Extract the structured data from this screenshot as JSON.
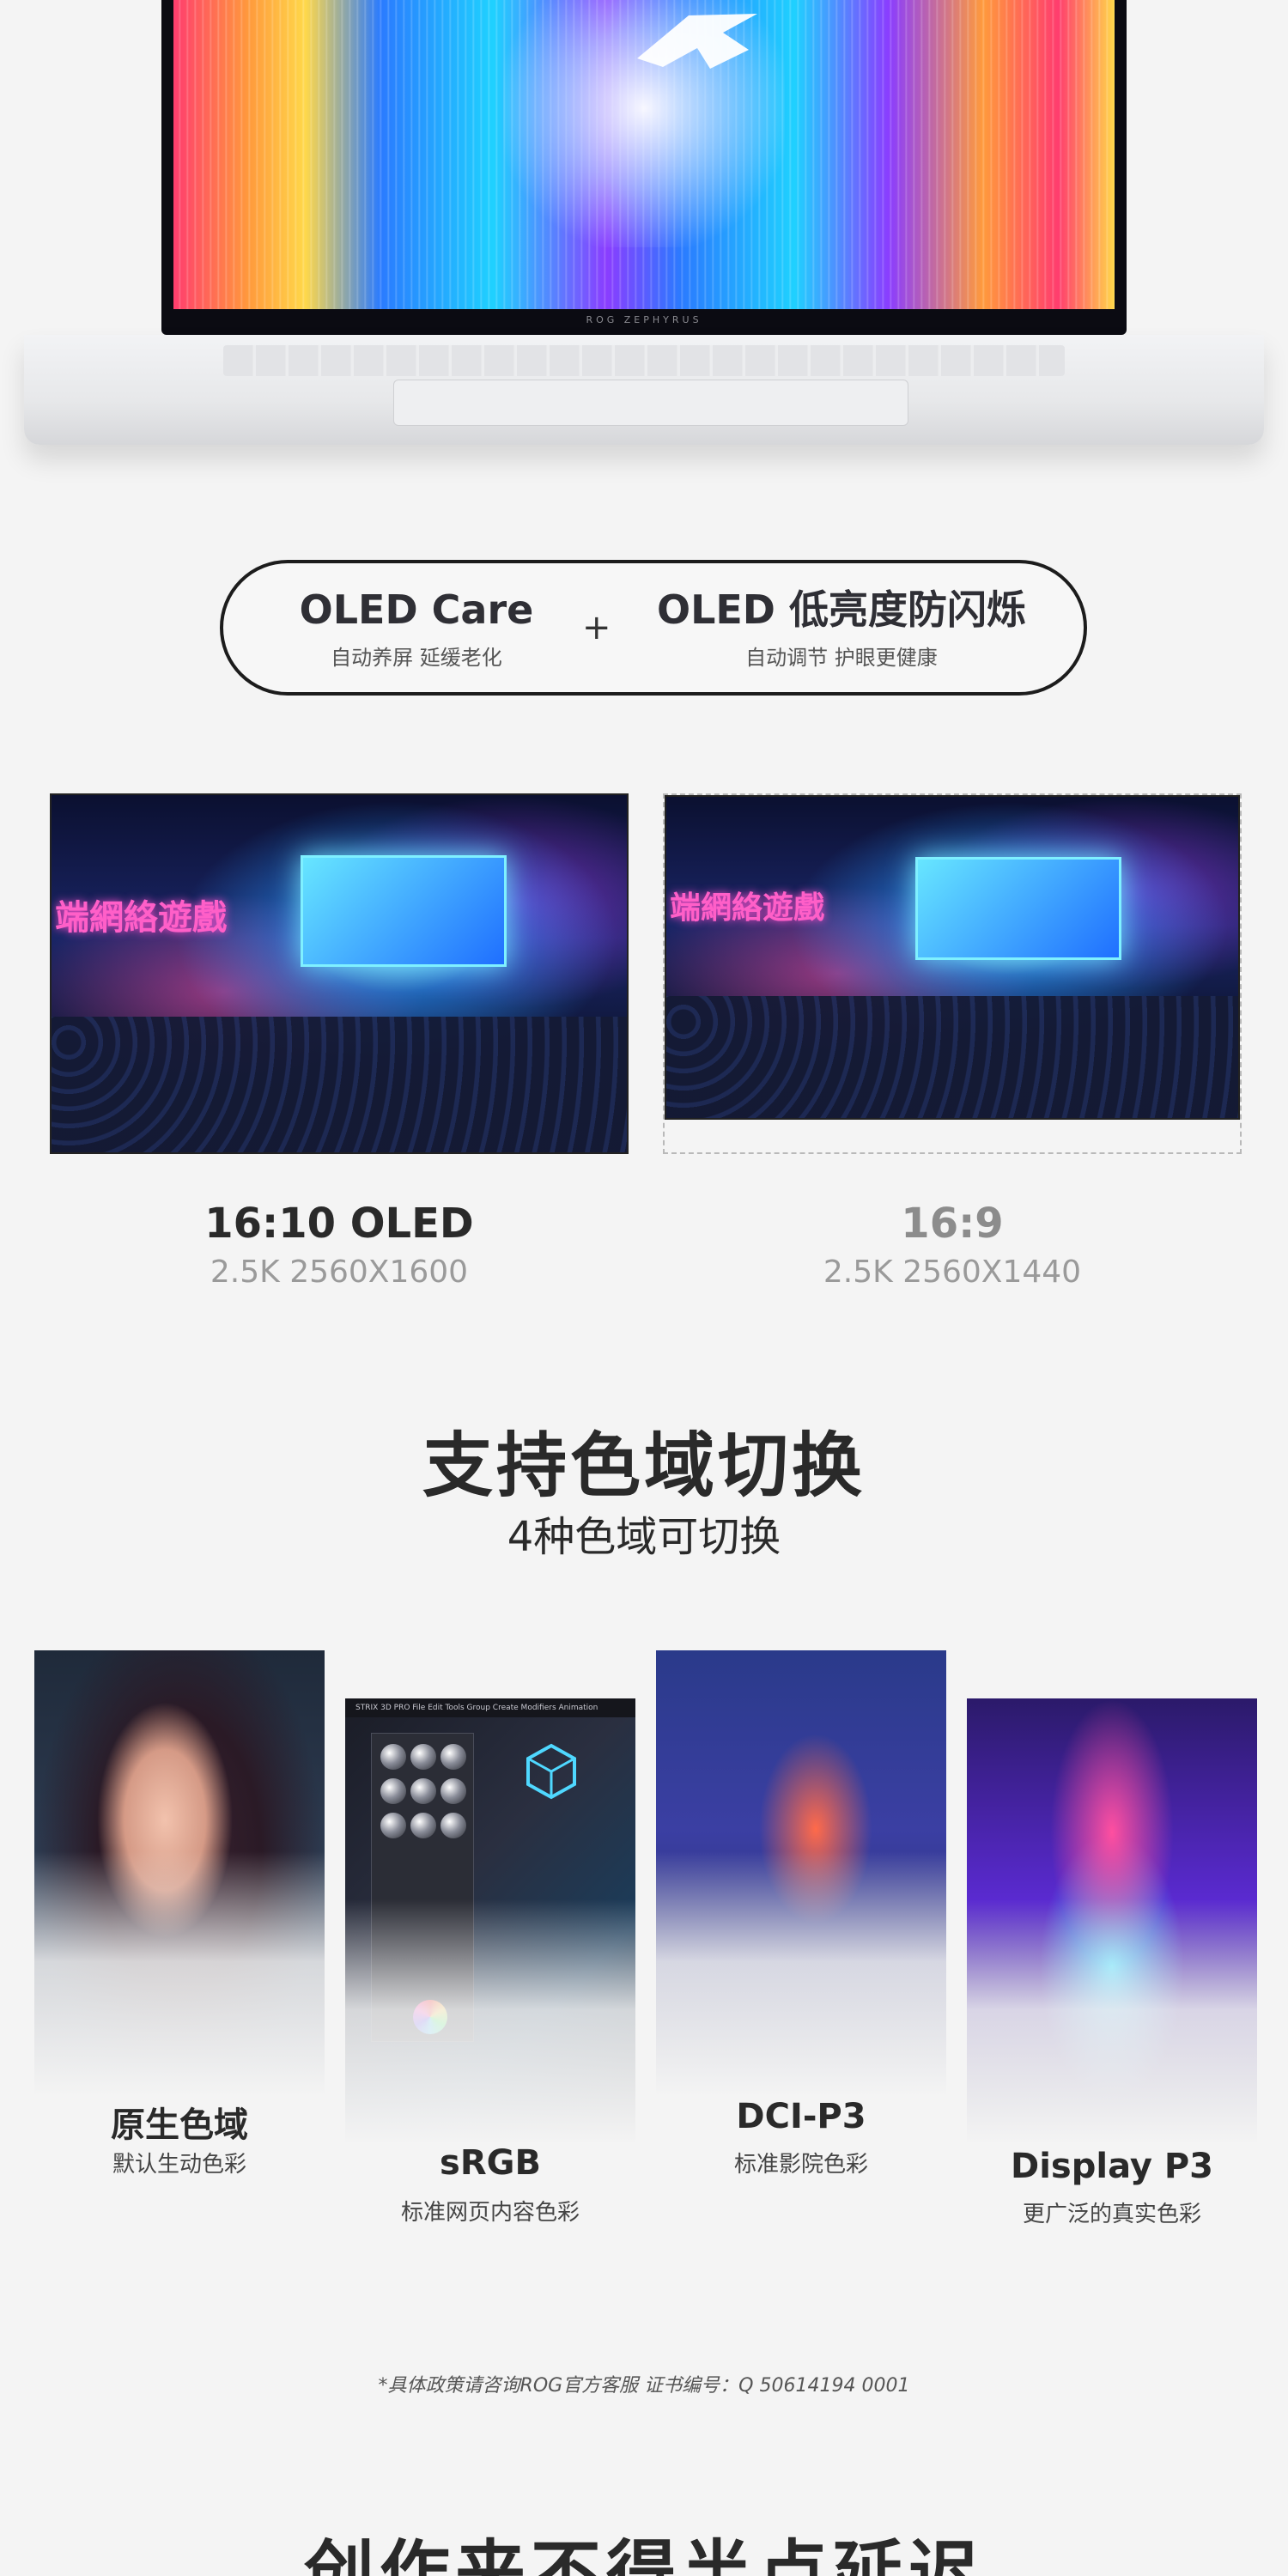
{
  "hero": {
    "brand_strip": "ROG ZEPHYRUS"
  },
  "oled_pill": {
    "left_title": "OLED Care",
    "left_sub": "自动养屏 延缓老化",
    "plus": "+",
    "right_title": "OLED 低亮度防闪烁",
    "right_sub": "自动调节 护眼更健康"
  },
  "compare": {
    "left": {
      "title": "16:10 OLED",
      "sub": "2.5K 2560X1600"
    },
    "right": {
      "title": "16:9",
      "sub": "2.5K 2560X1440"
    },
    "neon_text": "端網絡遊戲"
  },
  "gamut": {
    "heading": "支持色域切换",
    "sub": "4种色域可切换",
    "cards": [
      {
        "title": "原生色域",
        "sub": "默认生动色彩"
      },
      {
        "title": "sRGB",
        "sub": "标准网页内容色彩"
      },
      {
        "title": "DCI-P3",
        "sub": "标准影院色彩"
      },
      {
        "title": "Display P3",
        "sub": "更广泛的真实色彩"
      }
    ],
    "software_menu": "STRIX 3D PRO   File  Edit  Tools  Group  Create  Modifiers  Animation"
  },
  "footnote": "*具体政策请咨询ROG官方客服 证书编号：Q 50614194 0001",
  "next_heading": "创作来不得半点延迟",
  "colors": {
    "background": "#f4f4f4",
    "text": "#2a2a2a",
    "muted": "#9a9a9a",
    "pill_border": "#1c1c1c"
  }
}
